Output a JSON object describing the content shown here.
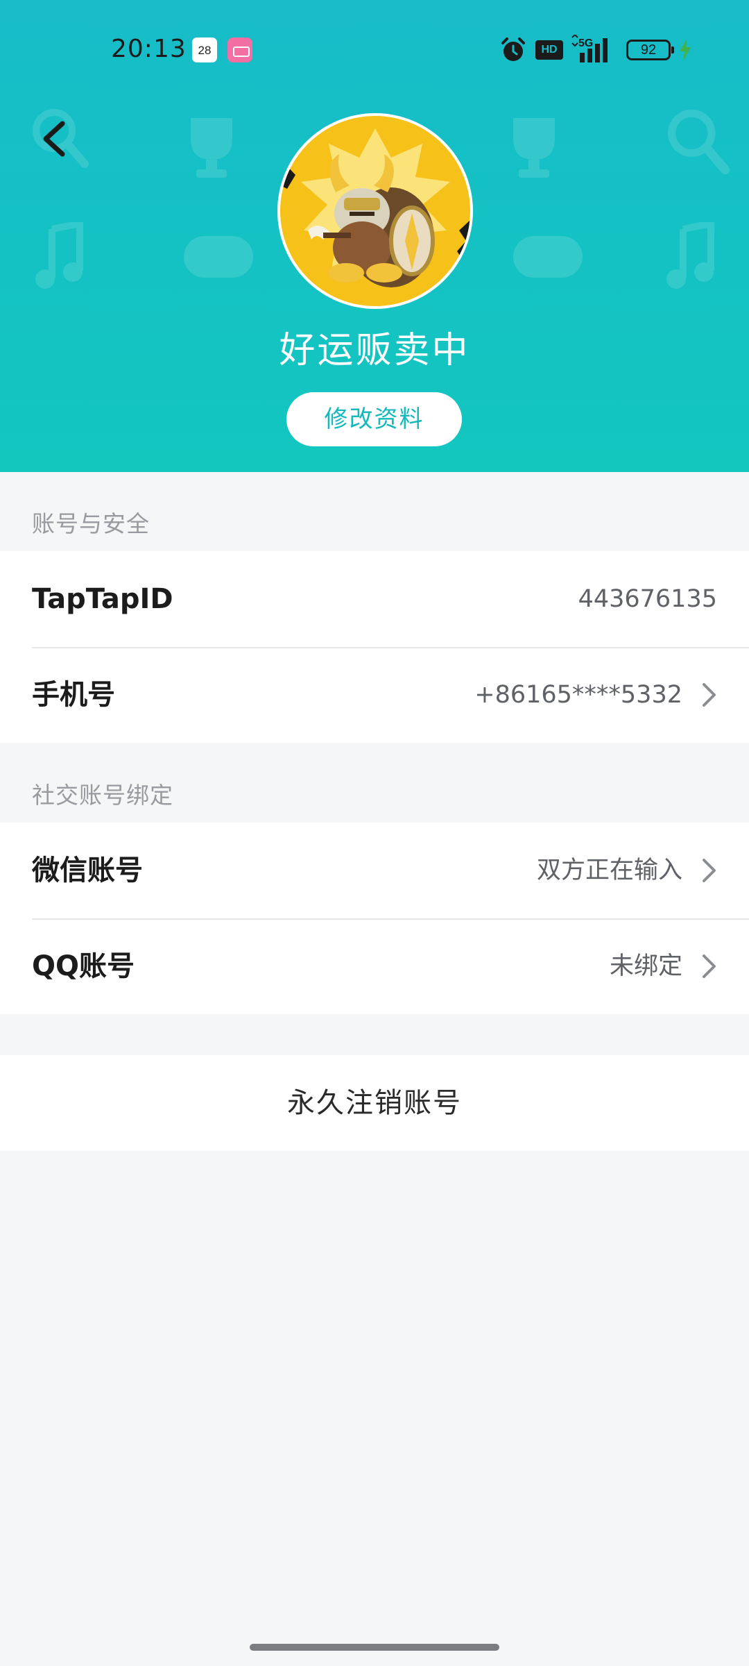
{
  "status_bar": {
    "time": "20:13",
    "calendar_day": "28",
    "hd_label": "HD",
    "network": "5G",
    "battery": "92"
  },
  "profile": {
    "username": "好运贩卖中",
    "edit_button": "修改资料"
  },
  "account_section": {
    "title": "账号与安全",
    "rows": [
      {
        "label": "TapTapID",
        "value": "443676135"
      },
      {
        "label": "手机号",
        "value": "+86165****5332"
      }
    ]
  },
  "social_section": {
    "title": "社交账号绑定",
    "rows": [
      {
        "label": "微信账号",
        "value": "双方正在输入"
      },
      {
        "label": "QQ账号",
        "value": "未绑定"
      }
    ]
  },
  "delete_account": "永久注销账号",
  "colors": {
    "header_teal": "#15bfc4",
    "accent": "#14b8bd",
    "page_bg": "#f5f6f8"
  }
}
